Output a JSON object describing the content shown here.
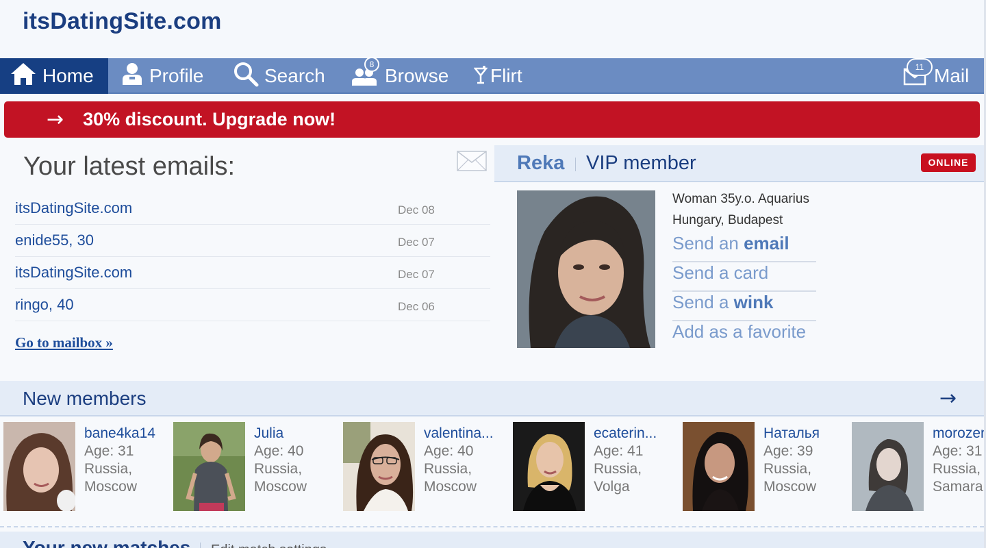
{
  "header": {
    "logo": "itsDatingSite.com"
  },
  "nav": {
    "items": [
      {
        "label": "Home",
        "icon": "home-icon",
        "active": true
      },
      {
        "label": "Profile",
        "icon": "profile-icon"
      },
      {
        "label": "Search",
        "icon": "magnifier-icon"
      },
      {
        "label": "Browse",
        "icon": "people-icon",
        "badge": "8"
      },
      {
        "label": "Flirt",
        "icon": "cocktail-icon"
      }
    ],
    "mail": {
      "label": "Mail",
      "icon": "mail-bubble-icon",
      "badge": "11"
    }
  },
  "promo": {
    "arrow": "→",
    "text": "30% discount. Upgrade now!"
  },
  "emails": {
    "title": "Your latest emails:",
    "icon": "envelope-icon",
    "items": [
      {
        "sender": "itsDatingSite.com",
        "date": "Dec 08"
      },
      {
        "sender": "enide55, 30",
        "date": "Dec 07"
      },
      {
        "sender": "itsDatingSite.com",
        "date": "Dec 07"
      },
      {
        "sender": "ringo, 40",
        "date": "Dec 06"
      }
    ],
    "mailbox_link": "Go to mailbox »"
  },
  "featured": {
    "name": "Reka",
    "status": "VIP member",
    "online": "ONLINE",
    "info_line1": "Woman 35y.o. Aquarius",
    "info_line2": "Hungary, Budapest",
    "actions": {
      "email_prefix": "Send an ",
      "email_bold": "email",
      "card": "Send a card",
      "wink_prefix": "Send a ",
      "wink_bold": "wink",
      "favorite": "Add as a favorite"
    }
  },
  "new_members": {
    "title": "New members",
    "arrow": "→",
    "members": [
      {
        "name": "bane4ka14",
        "age": "Age: 31",
        "country": "Russia,",
        "city": "Moscow"
      },
      {
        "name": "Julia",
        "age": "Age: 40",
        "country": "Russia,",
        "city": "Moscow"
      },
      {
        "name": "valentina...",
        "age": "Age: 40",
        "country": "Russia,",
        "city": "Moscow"
      },
      {
        "name": "ecaterin...",
        "age": "Age: 41",
        "country": "Russia,",
        "city": "Volga"
      },
      {
        "name": "Наталья",
        "age": "Age: 39",
        "country": "Russia,",
        "city": "Moscow"
      },
      {
        "name": "morozen",
        "age": "Age: 31",
        "country": "Russia,",
        "city": "Samara"
      }
    ]
  },
  "matches": {
    "title": "Your new matches",
    "edit": "Edit match settings"
  },
  "colors": {
    "nav": "#6b8cc2",
    "nav_active": "#163f83",
    "promo": "#c21324",
    "link": "#1e4d9b",
    "online": "#c8101f"
  }
}
